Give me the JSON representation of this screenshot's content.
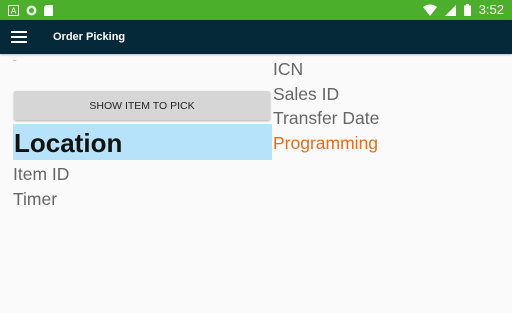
{
  "status_bar": {
    "time": "3:52",
    "left_icons": [
      "a-notification-icon",
      "circle-notification-icon",
      "sd-card-icon"
    ],
    "right_icons": [
      "wifi-icon",
      "cell-signal-icon",
      "battery-icon"
    ],
    "color": "#4caf2c"
  },
  "app_bar": {
    "title": "Order Picking",
    "menu_icon": "hamburger-menu-icon",
    "color": "#06293a"
  },
  "main": {
    "tiny_mark": "–",
    "show_button_label": "SHOW ITEM TO PICK",
    "location": "Location",
    "item_id": "Item ID",
    "timer": "Timer",
    "location_highlight_color": "#b7e3fa"
  },
  "right_panel": {
    "icn": "ICN",
    "sales_id": "Sales ID",
    "transfer_date": "Transfer Date",
    "status": "Programming",
    "status_color": "#ec6a16"
  }
}
